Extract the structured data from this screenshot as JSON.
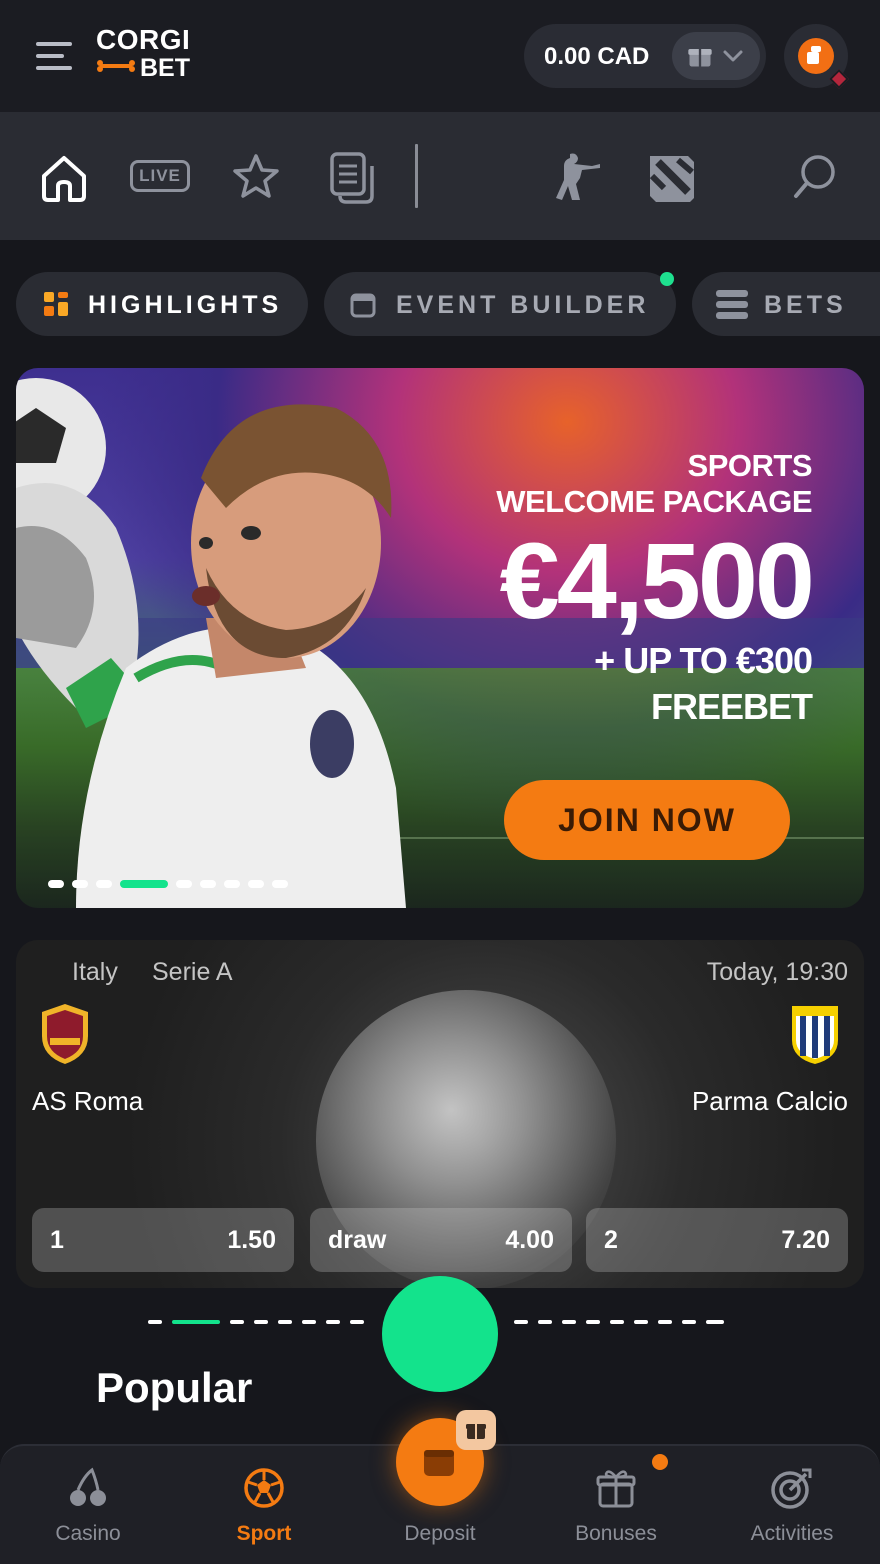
{
  "header": {
    "logo_top": "CORGI",
    "logo_bottom": "BET",
    "balance": "0.00 CAD"
  },
  "sport_nav": {
    "live_label": "LIVE"
  },
  "tabs": [
    {
      "label": "HIGHLIGHTS"
    },
    {
      "label": "EVENT BUILDER"
    },
    {
      "label": "BETS"
    }
  ],
  "banner": {
    "line1": "SPORTS",
    "line2": "WELCOME PACKAGE",
    "amount": "€4,500",
    "line3": "+ UP TO €300",
    "line4": "FREEBET",
    "cta": "JOIN NOW",
    "active_slide": 4,
    "slide_count": 10
  },
  "match": {
    "country": "Italy",
    "league": "Serie A",
    "time": "Today, 19:30",
    "home_team": "AS Roma",
    "away_team": "Parma Calcio",
    "odds": [
      {
        "label": "1",
        "value": "1.50"
      },
      {
        "label": "draw",
        "value": "4.00"
      },
      {
        "label": "2",
        "value": "7.20"
      }
    ]
  },
  "section_title": "Popular",
  "bottom_nav": [
    {
      "label": "Casino",
      "icon": "cherry-icon"
    },
    {
      "label": "Sport",
      "icon": "soccer-ball-icon"
    },
    {
      "label": "Deposit",
      "icon": "wallet-icon"
    },
    {
      "label": "Bonuses",
      "icon": "gift-icon"
    },
    {
      "label": "Activities",
      "icon": "target-icon"
    }
  ],
  "colors": {
    "accent_orange": "#f47b12",
    "accent_green": "#13e38c",
    "background": "#16171c"
  }
}
